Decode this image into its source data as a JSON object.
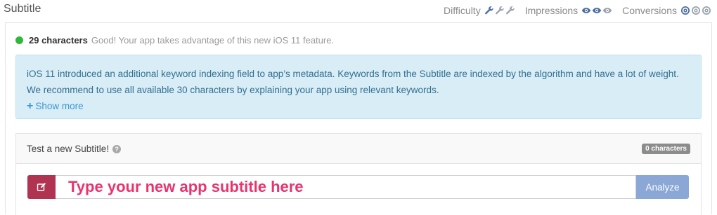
{
  "header": {
    "title": "Subtitle",
    "metrics": [
      {
        "label": "Difficulty",
        "icon": "wrench-icon",
        "level": 1,
        "max": 3
      },
      {
        "label": "Impressions",
        "icon": "eye-icon",
        "level": 2,
        "max": 3
      },
      {
        "label": "Conversions",
        "icon": "target-icon",
        "level": 1,
        "max": 3
      }
    ]
  },
  "status": {
    "count_label": "29 characters",
    "message": "Good! Your app takes advantage of this new iOS 11 feature.",
    "color": "#2fb83a"
  },
  "info": {
    "text": "iOS 11 introduced an additional keyword indexing field to app’s metadata. Keywords from the Subtitle are indexed by the algorithm and have a lot of weight. We recommend to use all available 30 characters by explaining your app using relevant keywords.",
    "show_more": "Show more"
  },
  "test": {
    "title": "Test a new Subtitle!",
    "char_count": "0 characters",
    "input_value": "",
    "input_placeholder": "Type your new app subtitle here",
    "analyze_label": "Analyze"
  },
  "colors": {
    "accent_red": "#b03451",
    "placeholder_pink": "#e8346e",
    "analyze_blue": "#8aa7d6",
    "info_bg": "#d9edf7"
  }
}
